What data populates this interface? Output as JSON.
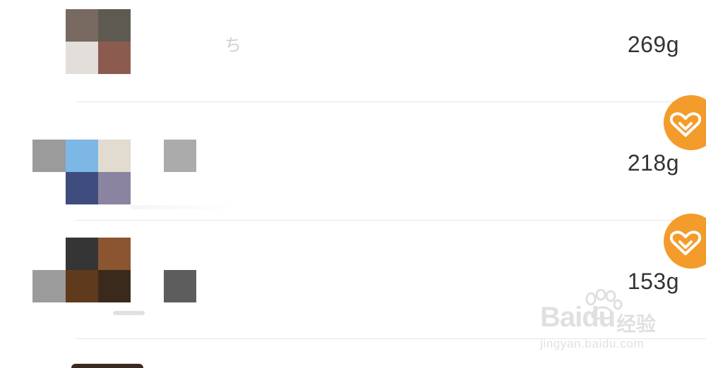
{
  "items": [
    {
      "weight": "269g",
      "favorite_badge": false,
      "thumbnail_colors": [
        "#786a60",
        "#5f5a51",
        "#e2ded9",
        "#8c5b4f"
      ]
    },
    {
      "weight": "218g",
      "favorite_badge": true,
      "thumbnail_colors": [
        "#9b9b9b",
        "#7db7e6",
        "#e2dbd0",
        "#ffffff",
        "#ffffff",
        "#3e4d7d",
        "#8a84a0"
      ],
      "extra_block_color": "#ababab"
    },
    {
      "weight": "153g",
      "favorite_badge": true,
      "thumbnail_colors": [
        "#ffffff",
        "#353535",
        "#8a5530",
        "#9b9b9b",
        "#5f3a1d",
        "#3a2a1b"
      ],
      "extra_block_color": "#5d5d5d"
    },
    {
      "weight": "",
      "favorite_badge": false,
      "thumbnail_colors": [
        "#3a2a22"
      ]
    }
  ],
  "icons": {
    "favorite": "heart-outline-icon"
  },
  "colors": {
    "badge": "#f39c2b",
    "divider": "#e6e6e6",
    "text": "#333333"
  },
  "watermark": {
    "logo": "Baidu",
    "label_cn": "经验",
    "url": "jingyan.baidu.com"
  }
}
